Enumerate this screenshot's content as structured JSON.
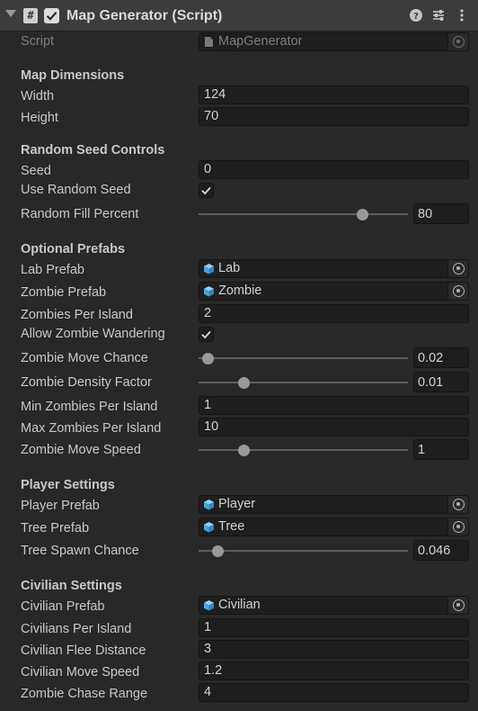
{
  "component": {
    "title": "Map Generator (Script)",
    "enabled": true,
    "icons": {
      "fold": "fold-arrow-icon",
      "script": "script-icon",
      "help": "help-icon",
      "presets": "presets-icon",
      "menu": "kebab-menu-icon"
    }
  },
  "script_field": {
    "label": "Script",
    "value": "MapGenerator"
  },
  "map_dimensions": {
    "heading": "Map Dimensions",
    "width": {
      "label": "Width",
      "value": "124"
    },
    "height": {
      "label": "Height",
      "value": "70"
    }
  },
  "random_seed": {
    "heading": "Random Seed Controls",
    "seed": {
      "label": "Seed",
      "value": "0"
    },
    "use_random_seed": {
      "label": "Use Random Seed",
      "checked": true
    },
    "random_fill_percent": {
      "label": "Random Fill Percent",
      "value": "80",
      "fraction": 0.8
    }
  },
  "optional_prefabs": {
    "heading": "Optional Prefabs",
    "lab_prefab": {
      "label": "Lab Prefab",
      "value": "Lab"
    },
    "zombie_prefab": {
      "label": "Zombie Prefab",
      "value": "Zombie"
    },
    "zombies_per_island": {
      "label": "Zombies Per Island",
      "value": "2"
    },
    "allow_zombie_wandering": {
      "label": "Allow Zombie Wandering",
      "checked": true
    },
    "zombie_move_chance": {
      "label": "Zombie Move Chance",
      "value": "0.02",
      "fraction": 0.02
    },
    "zombie_density_factor": {
      "label": "Zombie Density Factor",
      "value": "0.01",
      "fraction": 0.2
    },
    "min_zombies_per_island": {
      "label": "Min Zombies Per Island",
      "value": "1"
    },
    "max_zombies_per_island": {
      "label": "Max Zombies Per Island",
      "value": "10"
    },
    "zombie_move_speed": {
      "label": "Zombie Move Speed",
      "value": "1",
      "fraction": 0.2
    }
  },
  "player_settings": {
    "heading": "Player Settings",
    "player_prefab": {
      "label": "Player Prefab",
      "value": "Player"
    },
    "tree_prefab": {
      "label": "Tree Prefab",
      "value": "Tree"
    },
    "tree_spawn_chance": {
      "label": "Tree Spawn Chance",
      "value": "0.046",
      "fraction": 0.07
    }
  },
  "civilian_settings": {
    "heading": "Civilian Settings",
    "civilian_prefab": {
      "label": "Civilian Prefab",
      "value": "Civilian"
    },
    "civilians_per_island": {
      "label": "Civilians Per Island",
      "value": "1"
    },
    "civilian_flee_distance": {
      "label": "Civilian Flee Distance",
      "value": "3"
    },
    "civilian_move_speed": {
      "label": "Civilian Move Speed",
      "value": "1.2"
    },
    "zombie_chase_range": {
      "label": "Zombie Chase Range",
      "value": "4"
    }
  },
  "colors": {
    "panel_bg": "#282828",
    "header_bg": "#3c3c3c",
    "field_bg": "#1e1e1e",
    "prefab_icon": "#5fb4e6",
    "text": "#c8c8c8"
  }
}
